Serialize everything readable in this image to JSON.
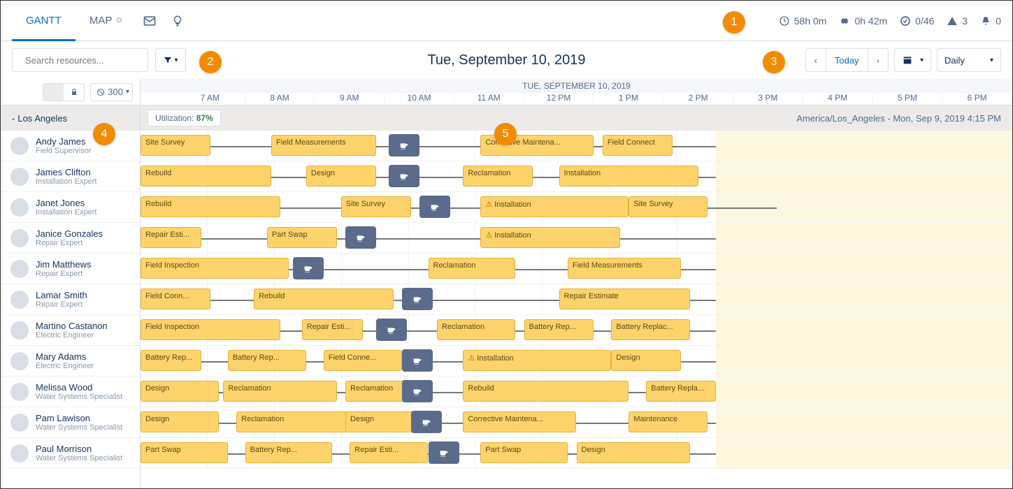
{
  "nav": {
    "tabs": [
      {
        "label": "GANTT",
        "active": true
      },
      {
        "label": "MAP",
        "active": false,
        "ext": true
      }
    ]
  },
  "kpis": {
    "time": "58h 0m",
    "drive": "0h 42m",
    "progress": "0/46",
    "violations": "3",
    "alerts": "0"
  },
  "search": {
    "placeholder": "Search resources..."
  },
  "date_title": "Tue, September 10, 2019",
  "today_label": "Today",
  "view_mode": "Daily",
  "gantt_date_header": "TUE, SEPTEMBER 10, 2019",
  "hours": [
    "7 AM",
    "8 AM",
    "9 AM",
    "10 AM",
    "11 AM",
    "12 PM",
    "1 PM",
    "2 PM",
    "3 PM",
    "4 PM",
    "5 PM",
    "6 PM"
  ],
  "count": "300",
  "territory": "Los Angeles",
  "util_label": "Utilization:",
  "util_value": "87%",
  "tz_text": "America/Los_Angeles - Mon, Sep 9, 2019 4:15 PM",
  "resources": [
    {
      "name": "Andy James",
      "title": "Field Supervisor"
    },
    {
      "name": "James Clifton",
      "title": "Installation Expert"
    },
    {
      "name": "Janet Jones",
      "title": "Installation Expert"
    },
    {
      "name": "Janice Gonzales",
      "title": "Repair Expert"
    },
    {
      "name": "Jim Matthews",
      "title": "Repair Expert"
    },
    {
      "name": "Lamar Smith",
      "title": "Repair Expert"
    },
    {
      "name": "Martino Castanon",
      "title": "Electric Engineer"
    },
    {
      "name": "Mary Adams",
      "title": "Electric Engineer"
    },
    {
      "name": "Melissa Wood",
      "title": "Water Systems Specialist"
    },
    {
      "name": "Pam Lawison",
      "title": "Water Systems Specialist"
    },
    {
      "name": "Paul Morrison",
      "title": "Water Systems Specialist"
    }
  ],
  "rows": [
    {
      "track_end": 66,
      "shade": [
        66,
        100
      ],
      "tasks": [
        {
          "l": 0,
          "w": 8,
          "t": "Site Survey"
        },
        {
          "l": 15,
          "w": 12,
          "t": "Field Measurements"
        },
        {
          "l": 39,
          "w": 13,
          "t": "Corrective Maintena..."
        },
        {
          "l": 53,
          "w": 8,
          "t": "Field Connect"
        }
      ],
      "breaks": [
        {
          "l": 28.5
        }
      ]
    },
    {
      "track_end": 66,
      "shade": [
        66,
        100
      ],
      "tasks": [
        {
          "l": 0,
          "w": 15,
          "t": "Rebuild"
        },
        {
          "l": 19,
          "w": 8,
          "t": "Design"
        },
        {
          "l": 37,
          "w": 8,
          "t": "Reclamation"
        },
        {
          "l": 48,
          "w": 16,
          "t": "Installation"
        }
      ],
      "breaks": [
        {
          "l": 28.5
        }
      ]
    },
    {
      "track_end": 73,
      "shade": [
        66,
        100
      ],
      "tasks": [
        {
          "l": 0,
          "w": 16,
          "t": "Rebuild"
        },
        {
          "l": 23,
          "w": 8,
          "t": "Site Survey"
        },
        {
          "l": 39,
          "w": 17,
          "t": "Installation",
          "warn": true
        },
        {
          "l": 56,
          "w": 9,
          "t": "Site Survey"
        }
      ],
      "breaks": [
        {
          "l": 32
        }
      ]
    },
    {
      "track_end": 66,
      "shade": [
        66,
        100
      ],
      "tasks": [
        {
          "l": 0,
          "w": 7,
          "t": "Repair Esti..."
        },
        {
          "l": 14.5,
          "w": 8,
          "t": "Part Swap"
        },
        {
          "l": 39,
          "w": 16,
          "t": "Installation",
          "warn": true
        }
      ],
      "breaks": [
        {
          "l": 23.5
        }
      ]
    },
    {
      "track_end": 66,
      "shade": [
        66,
        100
      ],
      "tasks": [
        {
          "l": 0,
          "w": 17,
          "t": "Field Inspection"
        },
        {
          "l": 33,
          "w": 10,
          "t": "Reclamation"
        },
        {
          "l": 49,
          "w": 13,
          "t": "Field Measurements"
        }
      ],
      "breaks": [
        {
          "l": 17.5
        }
      ]
    },
    {
      "track_end": 66,
      "shade": [
        66,
        100
      ],
      "tasks": [
        {
          "l": 0,
          "w": 8,
          "t": "Field Conn..."
        },
        {
          "l": 13,
          "w": 16,
          "t": "Rebuild"
        },
        {
          "l": 48,
          "w": 15,
          "t": "Repair Estimate"
        }
      ],
      "breaks": [
        {
          "l": 30
        }
      ]
    },
    {
      "track_end": 66,
      "shade": [
        66,
        100
      ],
      "tasks": [
        {
          "l": 0,
          "w": 16,
          "t": "Field Inspection"
        },
        {
          "l": 18.5,
          "w": 7,
          "t": "Repair Esti..."
        },
        {
          "l": 34,
          "w": 9,
          "t": "Reclamation"
        },
        {
          "l": 44,
          "w": 8,
          "t": "Battery Rep..."
        },
        {
          "l": 54,
          "w": 9,
          "t": "Battery Replac..."
        }
      ],
      "breaks": [
        {
          "l": 27
        }
      ]
    },
    {
      "track_end": 66,
      "shade": [
        66,
        100
      ],
      "tasks": [
        {
          "l": 0,
          "w": 7,
          "t": "Battery Rep..."
        },
        {
          "l": 10,
          "w": 9,
          "t": "Battery Rep..."
        },
        {
          "l": 21,
          "w": 9,
          "t": "Field Conne..."
        },
        {
          "l": 37,
          "w": 17,
          "t": "Installation",
          "warn": true
        },
        {
          "l": 54,
          "w": 8,
          "t": "Design"
        }
      ],
      "breaks": [
        {
          "l": 30
        }
      ]
    },
    {
      "track_end": 66,
      "shade": [
        66,
        100
      ],
      "tasks": [
        {
          "l": 0,
          "w": 9,
          "t": "Design"
        },
        {
          "l": 9.5,
          "w": 13,
          "t": "Reclamation"
        },
        {
          "l": 23.5,
          "w": 7,
          "t": "Reclamation"
        },
        {
          "l": 37,
          "w": 19,
          "t": "Rebuild"
        },
        {
          "l": 58,
          "w": 8,
          "t": "Battery Repla..."
        }
      ],
      "breaks": [
        {
          "l": 30
        }
      ]
    },
    {
      "track_end": 66,
      "shade": [
        66,
        100
      ],
      "tasks": [
        {
          "l": 0,
          "w": 9,
          "t": "Design"
        },
        {
          "l": 11,
          "w": 13,
          "t": "Reclamation"
        },
        {
          "l": 23.5,
          "w": 8,
          "t": "Design"
        },
        {
          "l": 37,
          "w": 13,
          "t": "Corrective Maintena..."
        },
        {
          "l": 56,
          "w": 9,
          "t": "Maintenance"
        }
      ],
      "breaks": [
        {
          "l": 31
        }
      ]
    },
    {
      "track_end": 66,
      "shade": [
        66,
        100
      ],
      "tasks": [
        {
          "l": 0,
          "w": 10,
          "t": "Part Swap"
        },
        {
          "l": 12,
          "w": 10,
          "t": "Battery Rep..."
        },
        {
          "l": 24,
          "w": 9,
          "t": "Repair Esti..."
        },
        {
          "l": 39,
          "w": 10,
          "t": "Part Swap"
        },
        {
          "l": 50,
          "w": 13,
          "t": "Design"
        }
      ],
      "breaks": [
        {
          "l": 33
        }
      ]
    }
  ],
  "callouts": [
    "1",
    "2",
    "3",
    "4",
    "5"
  ]
}
